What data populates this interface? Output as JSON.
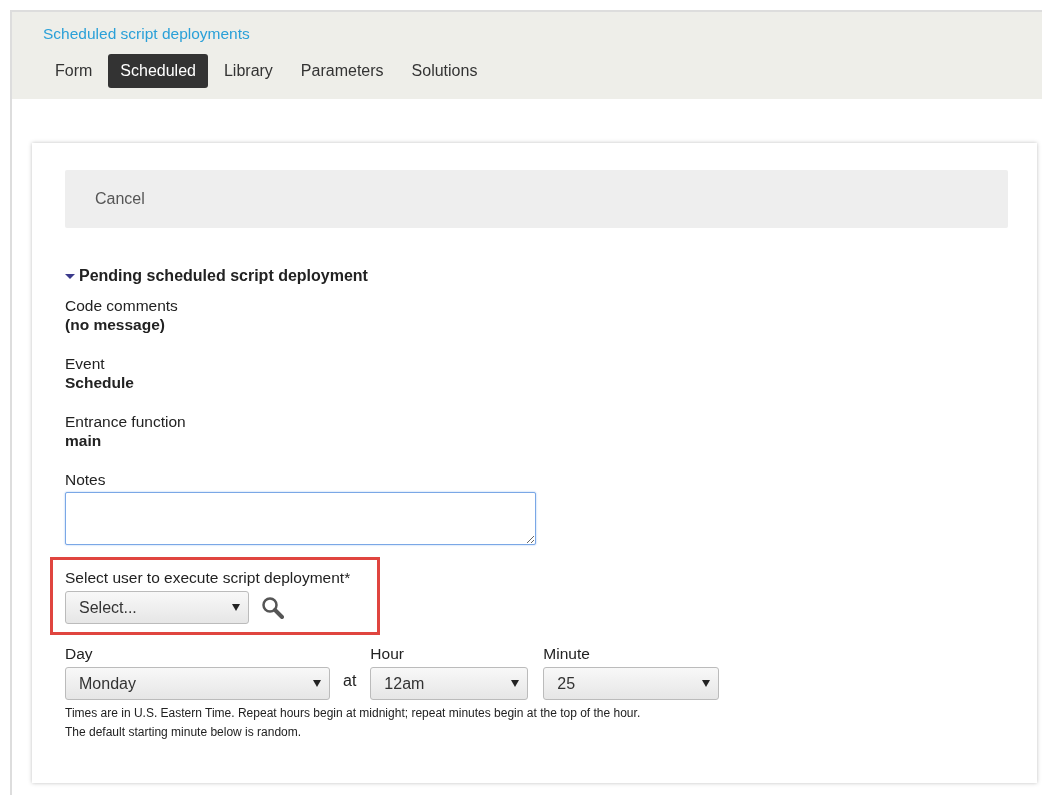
{
  "header": {
    "title_link": "Scheduled script deployments"
  },
  "tabs": [
    {
      "label": "Form",
      "selected": false
    },
    {
      "label": "Scheduled",
      "selected": true
    },
    {
      "label": "Library",
      "selected": false
    },
    {
      "label": "Parameters",
      "selected": false
    },
    {
      "label": "Solutions",
      "selected": false
    }
  ],
  "toolbar": {
    "cancel_button": "Cancel"
  },
  "section": {
    "title": "Pending scheduled script deployment",
    "expanded": true,
    "fields": [
      {
        "label": "Code comments",
        "value": "(no message)"
      },
      {
        "label": "Event",
        "value": "Schedule"
      },
      {
        "label": "Entrance function",
        "value": "main"
      }
    ],
    "notes": {
      "label": "Notes"
    },
    "user_select": {
      "label": "Select user to execute script deployment*",
      "value": "Select...",
      "highlighted": true
    },
    "schedule": {
      "day": {
        "label": "Day",
        "value": "Monday"
      },
      "connector": "at",
      "hour": {
        "label": "Hour",
        "value": "12am"
      },
      "minute": {
        "label": "Minute",
        "value": "25"
      }
    },
    "help": [
      "Times are in U.S. Eastern Time. Repeat hours begin at midnight; repeat minutes begin at the top of the hour.",
      "The default starting minute below is random."
    ]
  }
}
